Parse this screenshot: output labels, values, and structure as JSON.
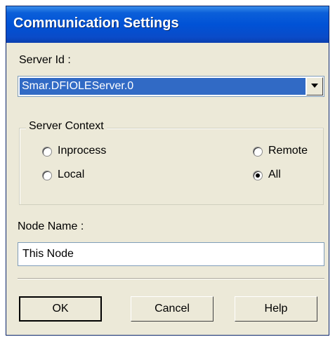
{
  "dialog": {
    "title": "Communication Settings"
  },
  "server_id": {
    "label": "Server Id :",
    "selected_value": "Smar.DFIOLEServer.0"
  },
  "server_context": {
    "legend": "Server Context",
    "options": [
      {
        "label": "Inprocess",
        "selected": false
      },
      {
        "label": "Local",
        "selected": false
      },
      {
        "label": "Remote",
        "selected": false
      },
      {
        "label": "All",
        "selected": true
      }
    ]
  },
  "node_name": {
    "label": "Node Name :",
    "value": "This Node"
  },
  "buttons": {
    "ok": "OK",
    "cancel": "Cancel",
    "help": "Help"
  }
}
